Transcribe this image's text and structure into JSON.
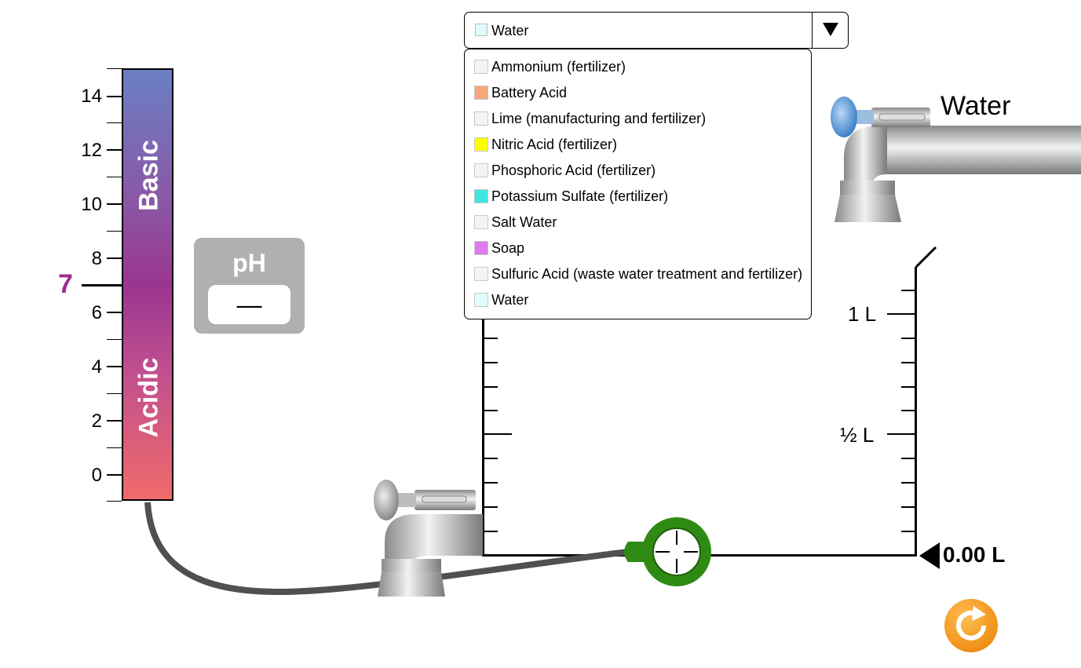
{
  "ph_scale": {
    "basic_label": "Basic",
    "acidic_label": "Acidic",
    "tick_labels": [
      "14",
      "12",
      "10",
      "8",
      "6",
      "4",
      "2",
      "0"
    ],
    "neutral_label": "7",
    "neutral_color": "#9b2c8d"
  },
  "ph_meter": {
    "title": "pH",
    "readout": "—"
  },
  "solute_selector": {
    "selected_label": "Water",
    "selected_color": "#e0fbfb",
    "options": [
      {
        "label": "Ammonium (fertilizer)",
        "color": "#f4f4f4"
      },
      {
        "label": "Battery Acid",
        "color": "#f4a77a"
      },
      {
        "label": "Lime (manufacturing and fertilizer)",
        "color": "#f4f4f4"
      },
      {
        "label": "Nitric Acid (fertilizer)",
        "color": "#ffff00"
      },
      {
        "label": "Phosphoric Acid (fertilizer)",
        "color": "#f4f4f4"
      },
      {
        "label": "Potassium Sulfate (fertilizer)",
        "color": "#3ee6e0"
      },
      {
        "label": "Salt Water",
        "color": "#f4f4f4"
      },
      {
        "label": "Soap",
        "color": "#e07aee"
      },
      {
        "label": "Sulfuric Acid (waste water treatment and fertilizer)",
        "color": "#f4f4f4"
      },
      {
        "label": "Water",
        "color": "#e0fbfb"
      }
    ]
  },
  "faucet": {
    "water_label": "Water"
  },
  "beaker": {
    "labels": [
      "1 L",
      "½ L"
    ],
    "volume_readout": "0.00 L"
  }
}
